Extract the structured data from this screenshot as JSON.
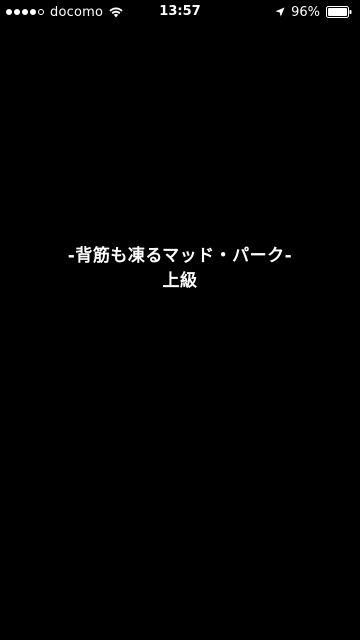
{
  "status_bar": {
    "carrier": "docomo",
    "time": "13:57",
    "battery": "96%",
    "signal_bars_filled": 4,
    "signal_bars_total": 5,
    "icons": {
      "wifi": "wifi-icon",
      "location": "location-arrow-icon",
      "battery": "battery-icon"
    }
  },
  "content": {
    "title": "-背筋も凍るマッド・パーク-",
    "subtitle": "上級"
  },
  "colors": {
    "background": "#000000",
    "text": "#ffffff"
  }
}
